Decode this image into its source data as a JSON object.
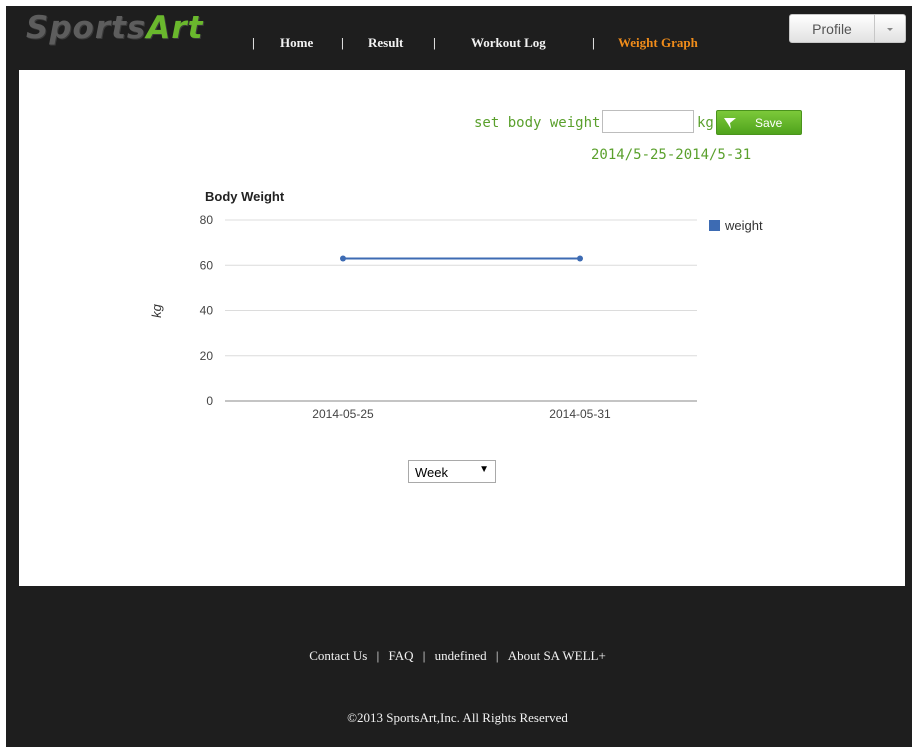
{
  "header": {
    "logo_main": "Sports",
    "logo_accent": "Art",
    "nav": [
      {
        "label": "Home",
        "active": false
      },
      {
        "label": "Result",
        "active": false
      },
      {
        "label": "Workout Log",
        "active": false
      },
      {
        "label": "Weight Graph",
        "active": true
      }
    ],
    "separator": "|",
    "profile_label": "Profile"
  },
  "weight_form": {
    "label": "set body weight:",
    "input_value": "",
    "unit": "kg",
    "save_label": "Save",
    "date_range": "2014/5-25-2014/5-31"
  },
  "period_select": {
    "selected": "Week"
  },
  "chart_data": {
    "type": "line",
    "title": "Body Weight",
    "ylabel": "kg",
    "xlabel": "",
    "x": [
      "2014-05-25",
      "2014-05-31"
    ],
    "series": [
      {
        "name": "weight",
        "values": [
          63,
          63
        ],
        "color": "#3d6bb3"
      }
    ],
    "ylim": [
      0,
      80
    ],
    "yticks": [
      0,
      20,
      40,
      60,
      80
    ],
    "grid": true,
    "legend": "right"
  },
  "footer": {
    "links": [
      "Contact Us",
      "FAQ",
      "undefined",
      "About SA WELL+"
    ],
    "separator": "|",
    "copyright": "©2013 SportsArt,Inc. All Rights Reserved"
  }
}
